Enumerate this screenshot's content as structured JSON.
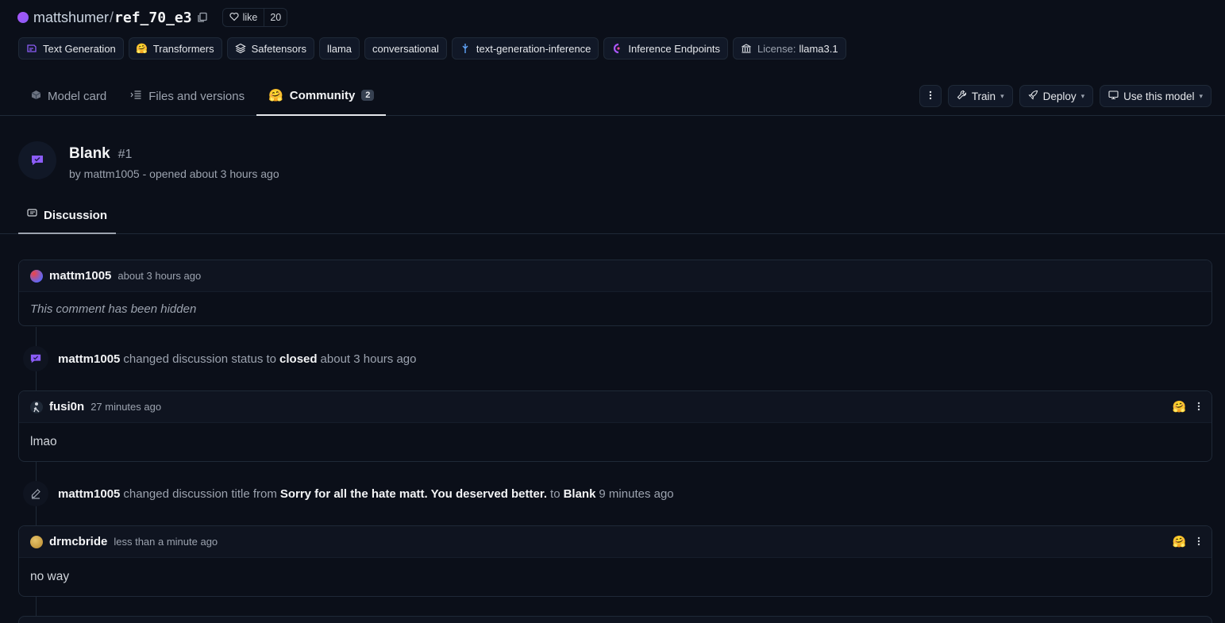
{
  "repo": {
    "owner": "mattshumer",
    "slash": "/",
    "name": "ref_70_e3",
    "like_label": "like",
    "like_count": "20"
  },
  "tags": [
    {
      "label": "Text Generation",
      "icon": "text-generation-icon"
    },
    {
      "label": "Transformers",
      "icon": "hugging-face-icon"
    },
    {
      "label": "Safetensors",
      "icon": "safetensors-icon"
    },
    {
      "label": "llama"
    },
    {
      "label": "conversational"
    },
    {
      "label": "text-generation-inference",
      "icon": "tgi-icon"
    },
    {
      "label": "Inference Endpoints",
      "icon": "inference-endpoints-icon"
    },
    {
      "prefix": "License:",
      "label": "llama3.1",
      "icon": "bank-icon"
    }
  ],
  "tabs": [
    {
      "label": "Model card",
      "icon": "cube-icon"
    },
    {
      "label": "Files and versions",
      "icon": "files-icon"
    },
    {
      "label": "Community",
      "icon": "hugging-face-icon",
      "count": "2",
      "active": true
    }
  ],
  "actions": {
    "train": "Train",
    "deploy": "Deploy",
    "use": "Use this model"
  },
  "discussion": {
    "title": "Blank",
    "number": "#1",
    "meta": "by mattm1005 - opened about 3 hours ago",
    "subtab": "Discussion"
  },
  "timeline": {
    "c1": {
      "author": "mattm1005",
      "time": "about 3 hours ago",
      "body": "This comment has been hidden",
      "avatar_color": "#6366f1"
    },
    "e1": {
      "actor": "mattm1005",
      "text": "changed discussion status to",
      "value": "closed",
      "time": "about 3 hours ago"
    },
    "c2": {
      "author": "fusi0n",
      "time": "27 minutes ago",
      "body": "lmao"
    },
    "e2": {
      "actor": "mattm1005",
      "text": "changed discussion title from",
      "from": "Sorry for all the hate matt. You deserved better.",
      "to_word": "to",
      "to": "Blank",
      "time": "9 minutes ago"
    },
    "c3": {
      "author": "drmcbride",
      "time": "less than a minute ago",
      "body": "no way",
      "avatar_color": "#d4a93c"
    }
  },
  "colors": {
    "background": "#0b0f19",
    "border": "#1f2937",
    "accent_purple": "#8b5cf6"
  }
}
